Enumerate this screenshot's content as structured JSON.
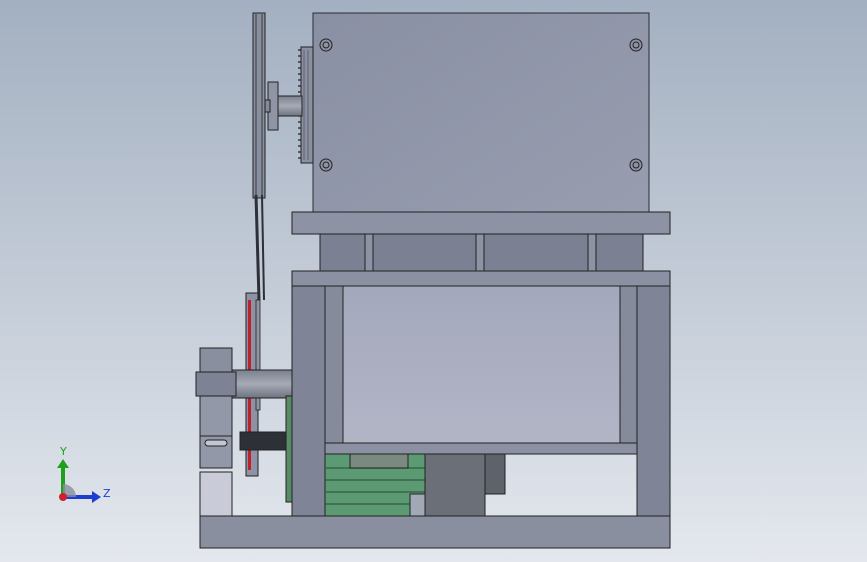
{
  "viewport": {
    "background_top": "#a3b0c1",
    "background_bottom": "#e4e8ee"
  },
  "model": {
    "body_color": "#8b92a5",
    "frame_color": "#7d8293",
    "panel_color": "#a9adc0",
    "belt_color": "#3a3d44",
    "red_accent": "#c0202a",
    "green_motor": "#5fa07a",
    "dark_gray": "#6a6e78"
  },
  "triad": {
    "y_label": "Y",
    "z_label": "Z",
    "y_color": "#1ea01e",
    "z_color": "#1c3fd0",
    "x_color": "#d0202a"
  }
}
